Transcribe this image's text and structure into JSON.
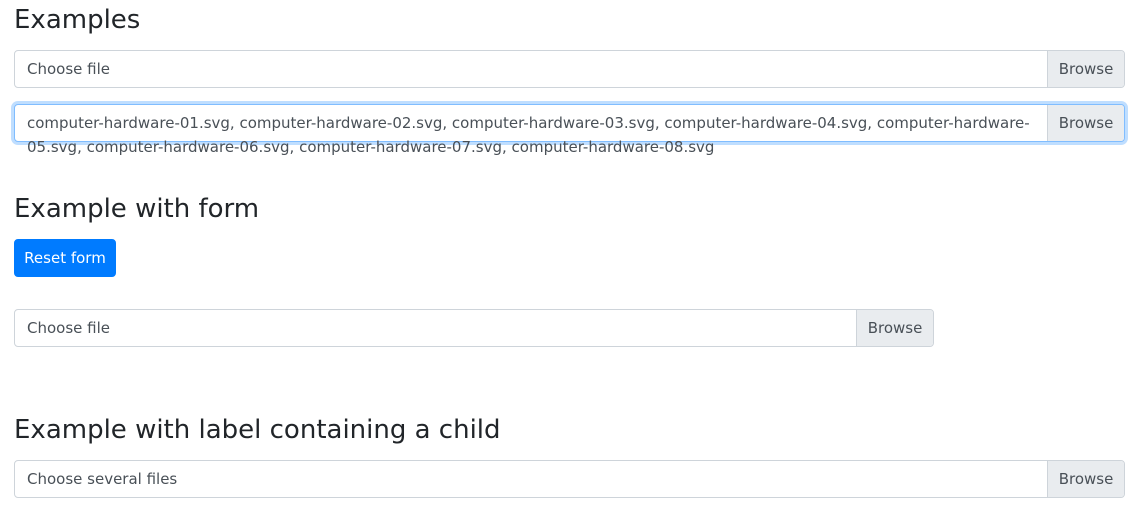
{
  "sections": {
    "examples": {
      "heading": "Examples",
      "single_input": {
        "label": "Choose file",
        "browse_label": "Browse"
      },
      "multi_input": {
        "label": "computer-hardware-01.svg, computer-hardware-02.svg, computer-hardware-03.svg, computer-hardware-04.svg, computer-hardware-05.svg, computer-hardware-06.svg, computer-hardware-07.svg, computer-hardware-08.svg",
        "browse_label": "Browse"
      }
    },
    "form_example": {
      "heading": "Example with form",
      "reset_label": "Reset form",
      "input": {
        "label": "Choose file",
        "browse_label": "Browse"
      }
    },
    "label_child_example": {
      "heading": "Example with label containing a child",
      "input": {
        "label": "Choose several files",
        "browse_label": "Browse"
      }
    }
  }
}
